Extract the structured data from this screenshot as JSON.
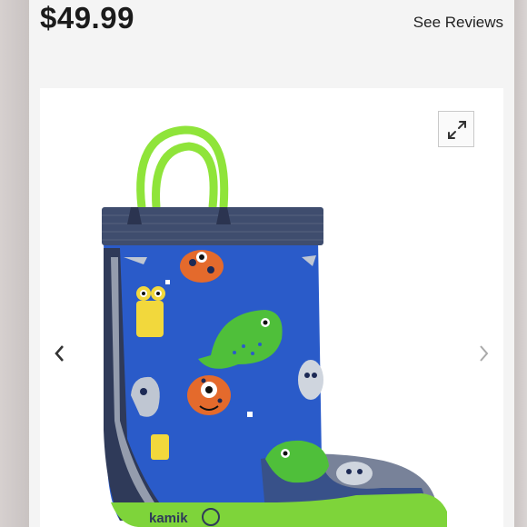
{
  "product": {
    "price": "$49.99",
    "reviews_link": "See Reviews"
  },
  "gallery": {
    "brand_logo": "kamik",
    "icons": {
      "expand": "expand-icon",
      "previous": "chevron-left-icon",
      "next": "chevron-right-icon"
    }
  },
  "colors": {
    "boot_blue": "#2a5bc9",
    "handle_green": "#8fe43a",
    "cuff_navy": "#3f4d6e",
    "price_text": "#1b1b1b"
  }
}
